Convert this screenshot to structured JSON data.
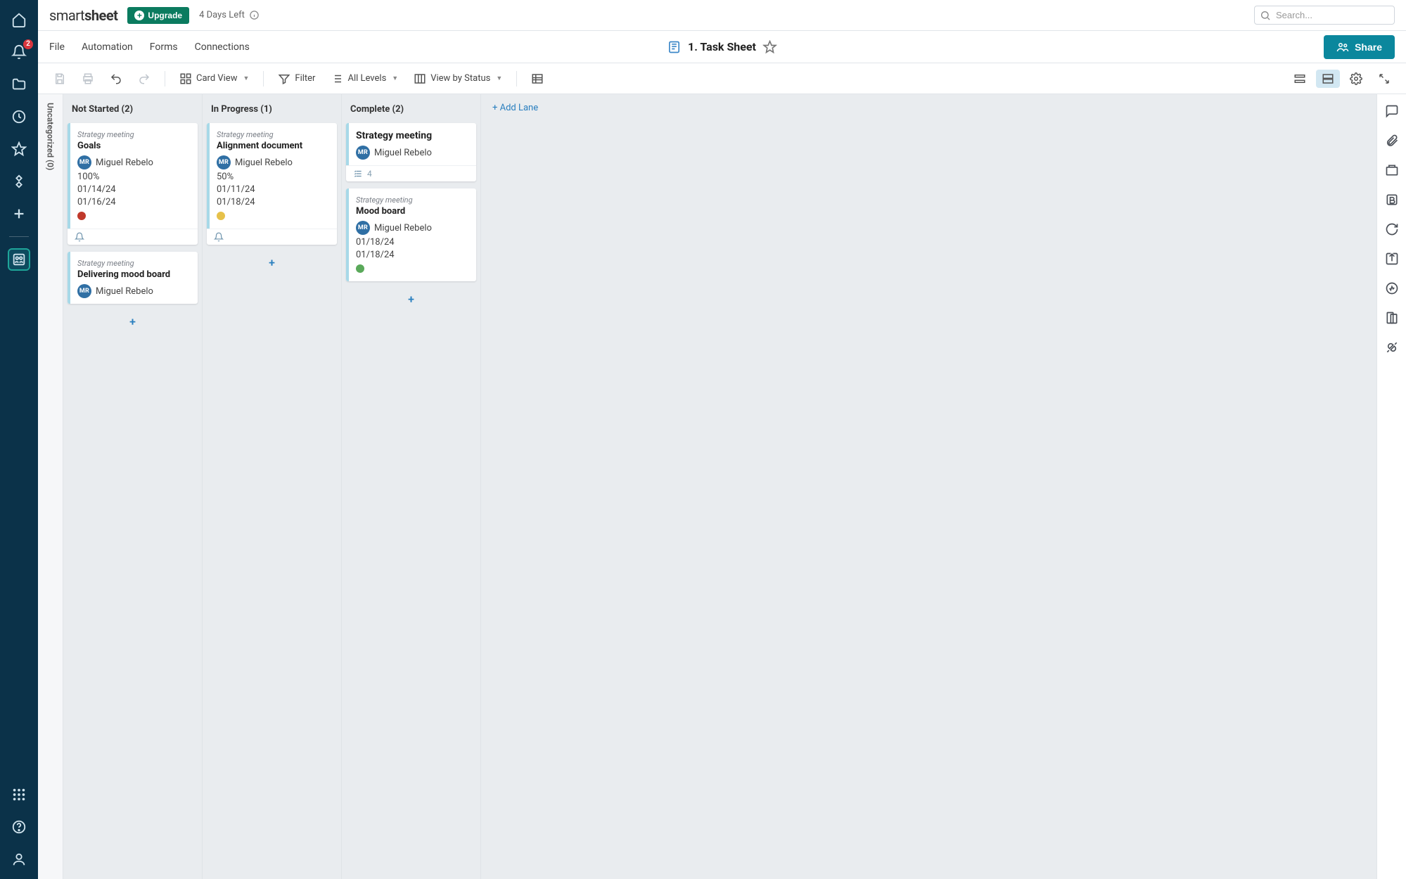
{
  "logo": {
    "light": "smart",
    "bold": "sheet"
  },
  "upgrade": {
    "label": "Upgrade"
  },
  "trial": {
    "days_left": "4 Days Left"
  },
  "search": {
    "placeholder": "Search..."
  },
  "notifications": {
    "count": "2"
  },
  "menu": {
    "file": "File",
    "automation": "Automation",
    "forms": "Forms",
    "connections": "Connections"
  },
  "sheet": {
    "title": "1. Task Sheet"
  },
  "share": {
    "label": "Share"
  },
  "toolbar": {
    "card_view": "Card View",
    "filter": "Filter",
    "all_levels": "All Levels",
    "view_by": "View by Status"
  },
  "uncategorized": {
    "label": "Uncategorized (0)"
  },
  "add_lane": {
    "label": "+ Add Lane"
  },
  "lanes": [
    {
      "title": "Not Started (2)",
      "cards": [
        {
          "category": "Strategy meeting",
          "title": "Goals",
          "assignee": {
            "initials": "MR",
            "name": "Miguel Rebelo"
          },
          "percent": "100%",
          "date1": "01/14/24",
          "date2": "01/16/24",
          "dot_color": "#c0392b",
          "foot_reminder": true
        },
        {
          "category": "Strategy meeting",
          "title": "Delivering mood board",
          "assignee": {
            "initials": "MR",
            "name": "Miguel Rebelo"
          }
        }
      ]
    },
    {
      "title": "In Progress (1)",
      "cards": [
        {
          "category": "Strategy meeting",
          "title": "Alignment document",
          "assignee": {
            "initials": "MR",
            "name": "Miguel Rebelo"
          },
          "percent": "50%",
          "date1": "01/11/24",
          "date2": "01/18/24",
          "dot_color": "#e6c14a",
          "foot_reminder": true
        }
      ]
    },
    {
      "title": "Complete (2)",
      "cards": [
        {
          "category": "Strategy meeting",
          "title_bold": false,
          "title": "Strategy meeting",
          "assignee": {
            "initials": "MR",
            "name": "Miguel Rebelo"
          },
          "foot_count": "4"
        },
        {
          "category": "Strategy meeting",
          "title": "Mood board",
          "assignee": {
            "initials": "MR",
            "name": "Miguel Rebelo"
          },
          "date1": "01/18/24",
          "date2": "01/18/24",
          "dot_color": "#5aa95a"
        }
      ]
    }
  ]
}
